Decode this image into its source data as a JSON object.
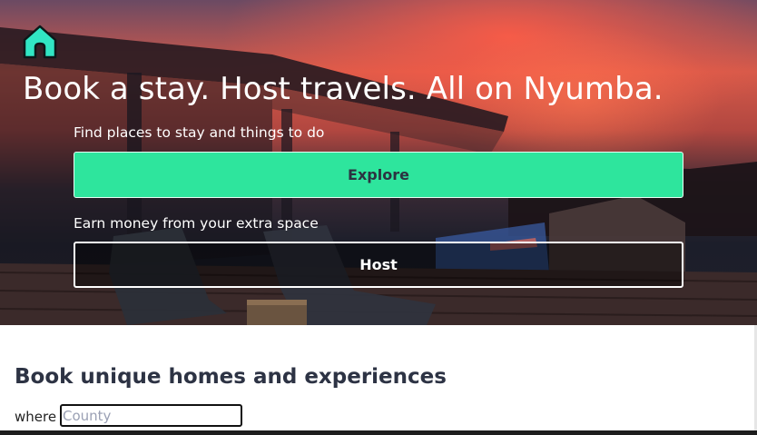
{
  "hero": {
    "headline": "Book a stay. Host travels. All on Nyumba.",
    "logo_icon": "home-icon",
    "explore_prompt": "Find places to stay and things to do",
    "explore_button": "Explore",
    "host_prompt": "Earn money from your extra space",
    "host_button": "Host"
  },
  "main": {
    "section_title": "Book unique homes and experiences",
    "where_label": "where",
    "county_placeholder": "County",
    "county_value": ""
  },
  "colors": {
    "accent": "#2ee59d",
    "logo": "#31e6c4",
    "heading_text": "#2d3344"
  }
}
